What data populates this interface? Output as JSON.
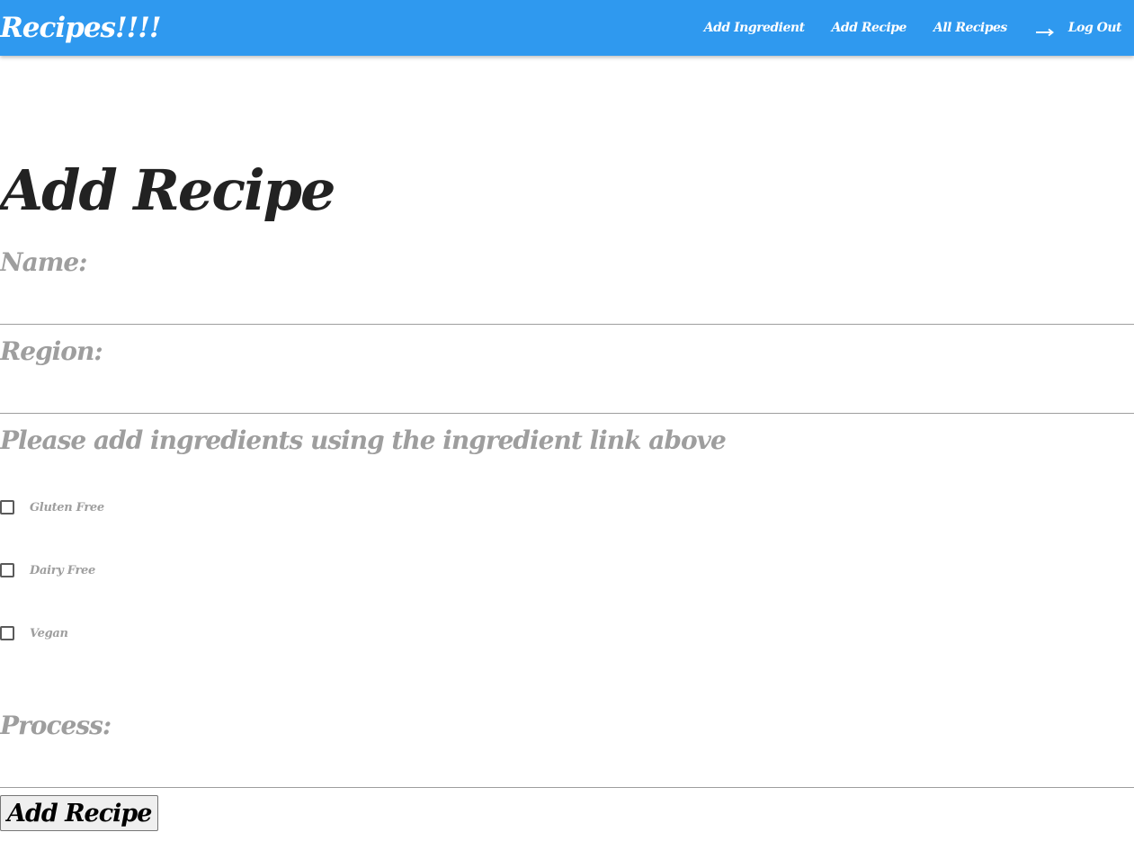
{
  "navbar": {
    "brand": "Recipes!!!!",
    "links": [
      {
        "label": "Add Ingredient"
      },
      {
        "label": "Add Recipe"
      },
      {
        "label": "All Recipes"
      }
    ],
    "logout_label": "Log Out",
    "logout_icon": "arrow-right-icon",
    "color": "#2f99ef"
  },
  "form": {
    "title": "Add Recipe",
    "name_label": "Name:",
    "name_value": "",
    "region_label": "Region:",
    "region_value": "",
    "ingredients_note": "Please add ingredients using the ingredient link above",
    "options": [
      {
        "label": "Gluten Free",
        "checked": false
      },
      {
        "label": "Dairy Free",
        "checked": false
      },
      {
        "label": "Vegan",
        "checked": false
      }
    ],
    "process_label": "Process:",
    "process_value": "",
    "submit_label": "Add Recipe"
  }
}
